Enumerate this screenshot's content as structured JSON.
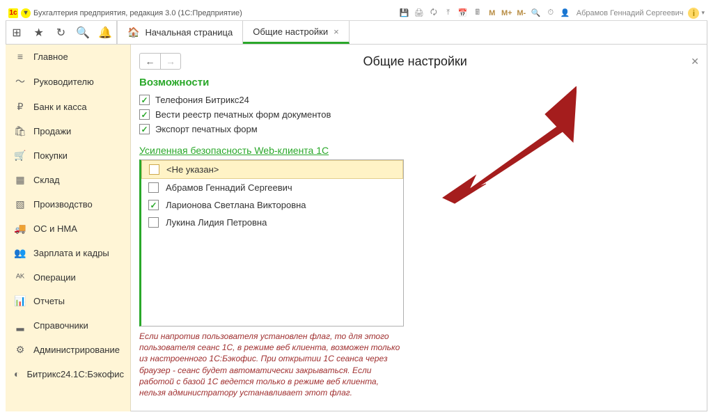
{
  "title": "Бухгалтерия предприятия, редакция 3.0  (1С:Предприятие)",
  "user": "Абрамов Геннадий Сергеевич",
  "m_buttons": [
    "M",
    "M+",
    "M-"
  ],
  "tabs": {
    "home": "Начальная страница",
    "settings": "Общие настройки"
  },
  "sidebar": [
    {
      "icon": "≡",
      "label": "Главное"
    },
    {
      "icon": "〜",
      "label": "Руководителю"
    },
    {
      "icon": "₽",
      "label": "Банк и касса"
    },
    {
      "icon": "🛍",
      "label": "Продажи"
    },
    {
      "icon": "🛒",
      "label": "Покупки"
    },
    {
      "icon": "▦",
      "label": "Склад"
    },
    {
      "icon": "▧",
      "label": "Производство"
    },
    {
      "icon": "🚚",
      "label": "ОС и НМА"
    },
    {
      "icon": "👥",
      "label": "Зарплата и кадры"
    },
    {
      "icon": "ᴬᴷ",
      "label": "Операции"
    },
    {
      "icon": "📊",
      "label": "Отчеты"
    },
    {
      "icon": "▂",
      "label": "Справочники"
    },
    {
      "icon": "⚙",
      "label": "Администрирование"
    },
    {
      "icon": "◐",
      "label": "Битрикс24.1С:Бэкофис"
    }
  ],
  "page": {
    "title": "Общие настройки",
    "section_caps": "Возможности",
    "caps": [
      "Телефония Битрикс24",
      "Вести реестр печатных форм документов",
      "Экспорт печатных форм"
    ],
    "sec_link": "Усиленная безопасность Web-клиента 1С",
    "users": [
      {
        "name": "<Не указан>",
        "checked": false,
        "selected": true
      },
      {
        "name": "Абрамов Геннадий Сергеевич",
        "checked": false,
        "selected": false
      },
      {
        "name": "Ларионова Светлана Викторовна",
        "checked": true,
        "selected": false
      },
      {
        "name": "Лукина Лидия Петровна",
        "checked": false,
        "selected": false
      }
    ],
    "hint": "Если напротив пользователя установлен флаг, то для этого пользователя сеанс 1С, в режиме веб клиента, возможен только из настроенного 1С:Бэкофис. При открытии 1С сеанса  через браузер - сеанс будет автоматически закрываться.  Если работой с базой 1С ведется только в режиме веб клиента, нельзя администратору устанавливает этот флаг."
  }
}
